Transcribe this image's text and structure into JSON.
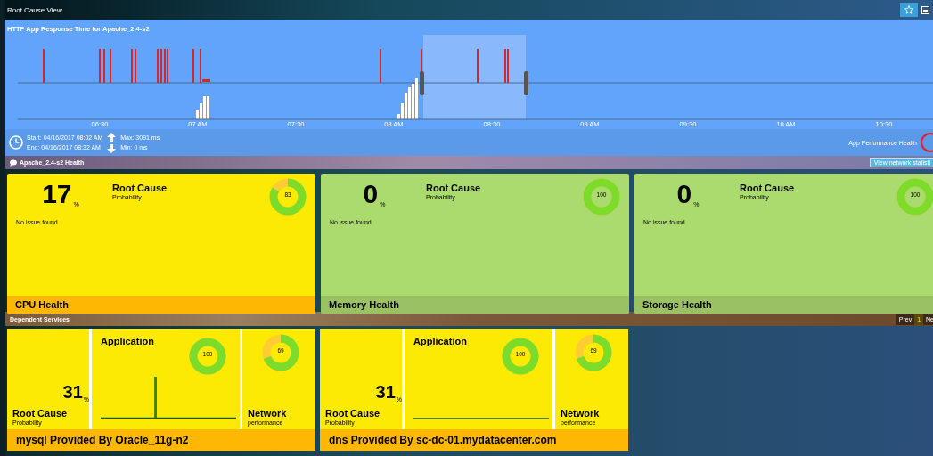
{
  "header": {
    "title": "Root Cause View"
  },
  "timeline": {
    "title": "HTTP App Response Time for Apache_2.4-s2",
    "axis_labels": [
      "06:30",
      "07 AM",
      "07:30",
      "08 AM",
      "08:30",
      "09 AM",
      "09:30",
      "10 AM",
      "10:30"
    ],
    "start": "Start: 04/16/2017 08:02 AM",
    "end": "End: 04/16/2017 08:32 AM",
    "max": "Max: 3091 ms",
    "min": "Min: 0 ms",
    "health_label": "App Performance Health"
  },
  "health_section": {
    "title": "Apache_2.4-s2 Health",
    "button": "View network statisti"
  },
  "health_cards": [
    {
      "name": "CPU Health",
      "kind": "warning",
      "value": "17",
      "unit": "%",
      "heading": "Root Cause",
      "subheading": "Probability",
      "message": "No issue found",
      "donut_value": "83"
    },
    {
      "name": "Memory Health",
      "kind": "ok",
      "value": "0",
      "unit": "%",
      "heading": "Root Cause",
      "subheading": "Probability",
      "message": "No issue found",
      "donut_value": "100"
    },
    {
      "name": "Storage Health",
      "kind": "ok",
      "value": "0",
      "unit": "%",
      "heading": "Root Cause",
      "subheading": "Probability",
      "message": "No issue found",
      "donut_value": "100"
    }
  ],
  "dependent_section": {
    "title": "Dependent Services",
    "pager": [
      {
        "label": "Prev",
        "selected": false
      },
      {
        "label": "1",
        "selected": true
      },
      {
        "label": "Ne",
        "selected": false
      }
    ]
  },
  "services": [
    {
      "title": "mysql Provided By Oracle_11g-n2",
      "value": "31",
      "unit": "%",
      "heading": "Root Cause",
      "subheading": "Probability",
      "app_title": "Application",
      "app_donut": "100",
      "spike": true,
      "net_title": "Network",
      "net_sub": "performance",
      "net_donut": "69"
    },
    {
      "title": "dns Provided By sc-dc-01.mydatacenter.com",
      "value": "31",
      "unit": "%",
      "heading": "Root Cause",
      "subheading": "Probability",
      "app_title": "Application",
      "app_donut": "100",
      "spike": false,
      "net_title": "Network",
      "net_sub": "performance",
      "net_donut": "69"
    }
  ]
}
